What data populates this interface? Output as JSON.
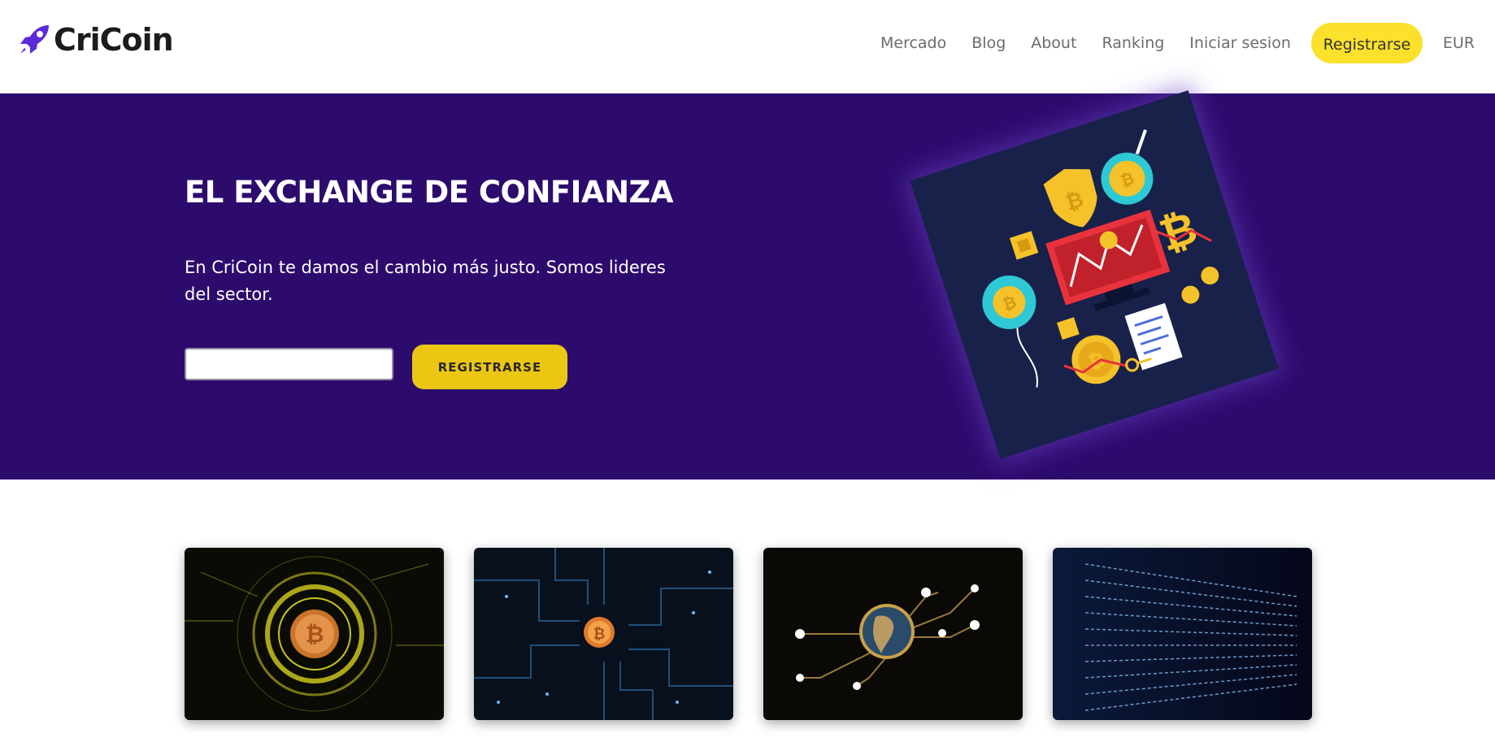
{
  "header": {
    "brand": "CriCoin",
    "logo_icon": "rocket-icon",
    "nav": [
      "Mercado",
      "Blog",
      "About",
      "Ranking",
      "Iniciar sesion"
    ],
    "cta": "Registrarse",
    "currency": "EUR"
  },
  "hero": {
    "title": "EL EXCHANGE DE CONFIANZA",
    "subtitle": "En CriCoin te damos el cambio más justo. Somos lideres del sector.",
    "email_value": "",
    "button": "REGISTRARSE",
    "illustration": "crypto-finance-illustration"
  },
  "cards": [
    {
      "image": "golden-bitcoin-hud-image"
    },
    {
      "image": "circuit-board-bitcoin-image"
    },
    {
      "image": "globe-network-image"
    },
    {
      "image": "code-stream-image"
    }
  ],
  "colors": {
    "hero_bg": "#2d0b6d",
    "accent_yellow": "#fbe12b",
    "button_yellow": "#ebc714",
    "logo_purple": "#5b2bd8",
    "text_dark": "#1c1c1c",
    "nav_text": "#6b6b6b"
  }
}
